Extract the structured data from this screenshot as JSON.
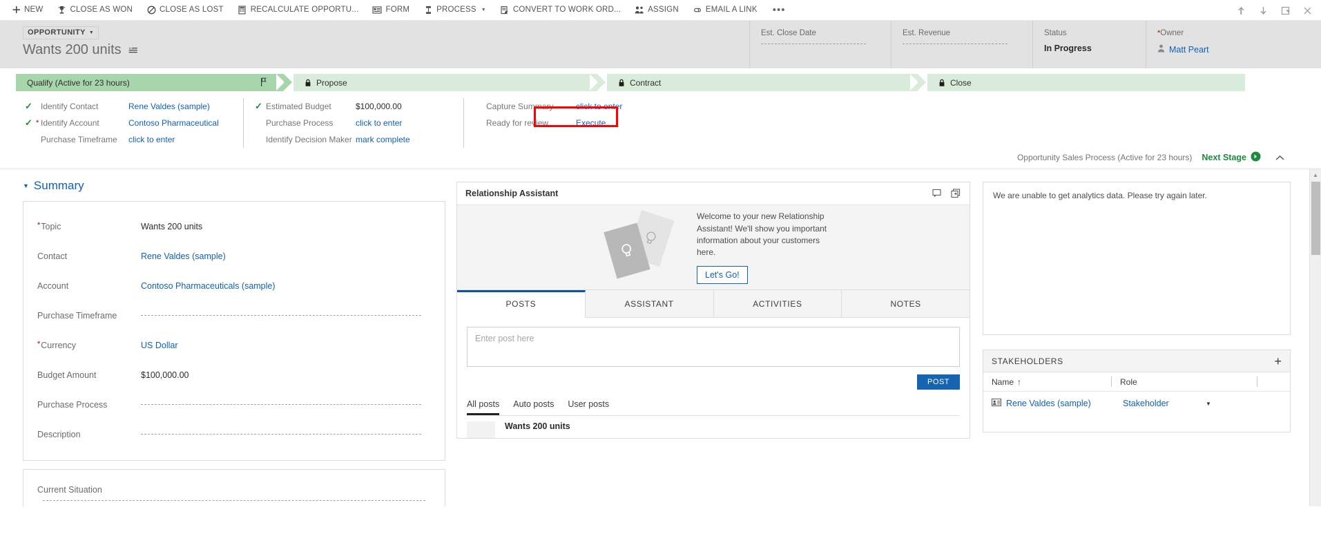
{
  "command_bar": {
    "items": [
      {
        "label": "NEW",
        "icon": "plus-icon"
      },
      {
        "label": "CLOSE AS WON",
        "icon": "trophy-icon"
      },
      {
        "label": "CLOSE AS LOST",
        "icon": "no-entry-icon"
      },
      {
        "label": "RECALCULATE OPPORTU...",
        "icon": "calculator-icon"
      },
      {
        "label": "FORM",
        "icon": "form-icon"
      },
      {
        "label": "PROCESS",
        "icon": "process-icon",
        "has_caret": true
      },
      {
        "label": "CONVERT TO WORK ORD...",
        "icon": "clipboard-icon"
      },
      {
        "label": "ASSIGN",
        "icon": "assign-users-icon"
      },
      {
        "label": "EMAIL A LINK",
        "icon": "link-icon"
      }
    ],
    "overflow_label": "•••",
    "window_controls": [
      {
        "name": "previous-record-icon",
        "glyph": "↑"
      },
      {
        "name": "next-record-icon",
        "glyph": "↓"
      },
      {
        "name": "popout-icon",
        "glyph": "⬚"
      },
      {
        "name": "close-icon",
        "glyph": "✕"
      }
    ]
  },
  "record_header": {
    "entity_type": "OPPORTUNITY",
    "title": "Wants 200 units",
    "fields": [
      {
        "label": "Est. Close Date",
        "value": "",
        "required": false,
        "empty": true
      },
      {
        "label": "Est. Revenue",
        "value": "",
        "required": false,
        "empty": true
      },
      {
        "label": "Status",
        "value": "In Progress",
        "required": false,
        "empty": false
      },
      {
        "label": "Owner",
        "value": "Matt Peart",
        "required": true,
        "empty": false,
        "is_link": true
      }
    ]
  },
  "business_process": {
    "stages": [
      {
        "label": "Qualify (Active for 23 hours)",
        "active": true,
        "locked": false
      },
      {
        "label": "Propose",
        "active": false,
        "locked": true
      },
      {
        "label": "Contract",
        "active": false,
        "locked": true
      },
      {
        "label": "Close",
        "active": false,
        "locked": true
      }
    ],
    "step_columns": [
      {
        "steps": [
          {
            "label": "Identify Contact",
            "value": "Rene Valdes (sample)",
            "checked": true,
            "required": false,
            "is_link": true
          },
          {
            "label": "Identify Account",
            "value": "Contoso Pharmaceutical",
            "checked": true,
            "required": true,
            "is_link": true
          },
          {
            "label": "Purchase Timeframe",
            "value": "click to enter",
            "checked": false,
            "required": false,
            "is_link": true
          }
        ]
      },
      {
        "steps": [
          {
            "label": "Estimated Budget",
            "value": "$100,000.00",
            "checked": true,
            "required": false,
            "is_link": false
          },
          {
            "label": "Purchase Process",
            "value": "click to enter",
            "checked": false,
            "required": false,
            "is_link": true
          },
          {
            "label": "Identify Decision Maker",
            "value": "mark complete",
            "checked": false,
            "required": false,
            "is_link": true
          }
        ]
      },
      {
        "steps": [
          {
            "label": "Capture Summary",
            "value": "click to enter",
            "checked": false,
            "required": false,
            "is_link": true
          },
          {
            "label": "Ready for review",
            "value": "Execute",
            "checked": false,
            "required": false,
            "is_link": true,
            "highlighted": true
          }
        ]
      }
    ],
    "process_name": "Opportunity Sales Process (Active for 23 hours)",
    "next_stage_label": "Next Stage",
    "highlight_color": "#ff0000"
  },
  "summary": {
    "heading": "Summary",
    "fields": [
      {
        "label": "Topic",
        "value": "Wants 200 units",
        "required": true,
        "is_link": false,
        "empty": false
      },
      {
        "label": "Contact",
        "value": "Rene Valdes (sample)",
        "required": false,
        "is_link": true,
        "empty": false
      },
      {
        "label": "Account",
        "value": "Contoso Pharmaceuticals (sample)",
        "required": false,
        "is_link": true,
        "empty": false
      },
      {
        "label": "Purchase Timeframe",
        "value": "",
        "required": false,
        "is_link": false,
        "empty": true
      },
      {
        "label": "Currency",
        "value": "US Dollar",
        "required": true,
        "is_link": true,
        "empty": false
      },
      {
        "label": "Budget Amount",
        "value": "$100,000.00",
        "required": false,
        "is_link": false,
        "empty": false
      },
      {
        "label": "Purchase Process",
        "value": "",
        "required": false,
        "is_link": false,
        "empty": true
      },
      {
        "label": "Description",
        "value": "",
        "required": false,
        "is_link": false,
        "empty": true
      }
    ],
    "current_situation_label": "Current Situation"
  },
  "relationship_assistant": {
    "title": "Relationship Assistant",
    "welcome_text": "Welcome to your new Relationship Assistant! We'll show you important information about your customers here.",
    "cta_label": "Let's Go!"
  },
  "social_pane": {
    "tabs": [
      {
        "label": "POSTS",
        "active": true
      },
      {
        "label": "ASSISTANT",
        "active": false
      },
      {
        "label": "ACTIVITIES",
        "active": false
      },
      {
        "label": "NOTES",
        "active": false
      }
    ],
    "post_placeholder": "Enter post here",
    "post_button_label": "POST",
    "filters": [
      {
        "label": "All posts",
        "active": true
      },
      {
        "label": "Auto posts",
        "active": false
      },
      {
        "label": "User posts",
        "active": false
      }
    ],
    "posts": [
      {
        "title": "Wants 200 units"
      }
    ]
  },
  "analytics": {
    "message": "We are unable to get analytics data. Please try again later."
  },
  "stakeholders": {
    "title": "STAKEHOLDERS",
    "add_label": "+",
    "columns": [
      {
        "label": "Name",
        "sort": "↑"
      },
      {
        "label": "Role",
        "sort": ""
      }
    ],
    "rows": [
      {
        "name": "Rene Valdes (sample)",
        "role": "Stakeholder"
      }
    ]
  }
}
